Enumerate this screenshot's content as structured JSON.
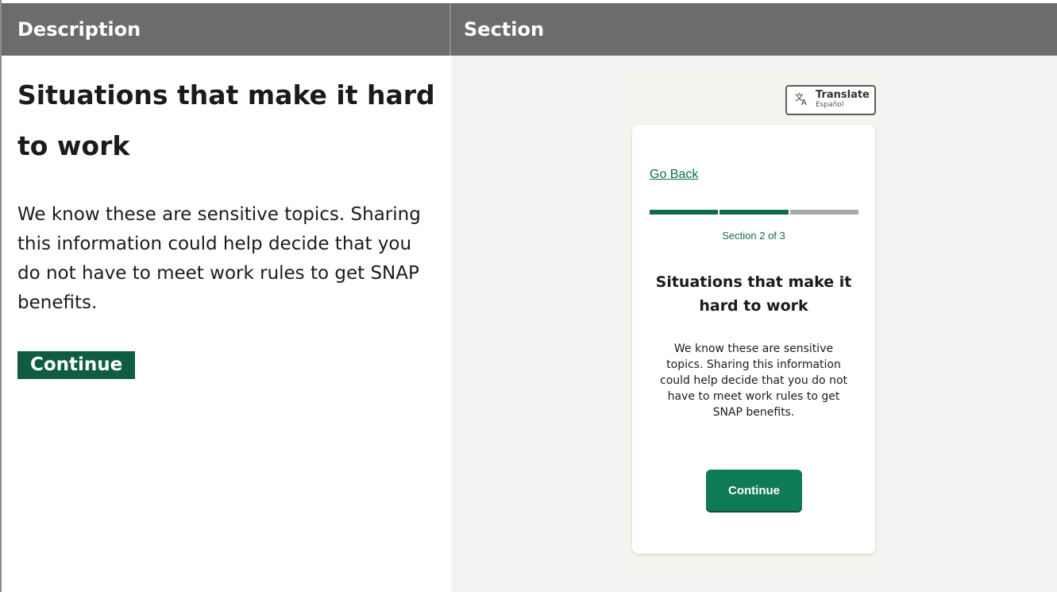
{
  "table": {
    "headers": [
      "Description",
      "Section"
    ]
  },
  "description": {
    "title": "Situations that make it hard to work",
    "body": "We know these are sensitive topics. Sharing this information could help decide that you do not have to meet work rules to get SNAP benefits.",
    "continue_label": "Continue"
  },
  "preview": {
    "translate": {
      "label": "Translate",
      "sublabel": "Español",
      "icon": "translate-icon"
    },
    "go_back": "Go Back",
    "progress": {
      "current": 2,
      "total": 3,
      "label": "Section 2 of 3"
    },
    "title": "Situations that make it hard to work",
    "body": "We know these are sensitive topics. Sharing this information could help decide that you do not have to meet work rules to get SNAP benefits.",
    "continue_label": "Continue"
  },
  "colors": {
    "header_bg": "#6c6c6c",
    "brand_green": "#0f7a58",
    "dark_green": "#0f5c44",
    "progress_todo": "#a7a9ab"
  }
}
